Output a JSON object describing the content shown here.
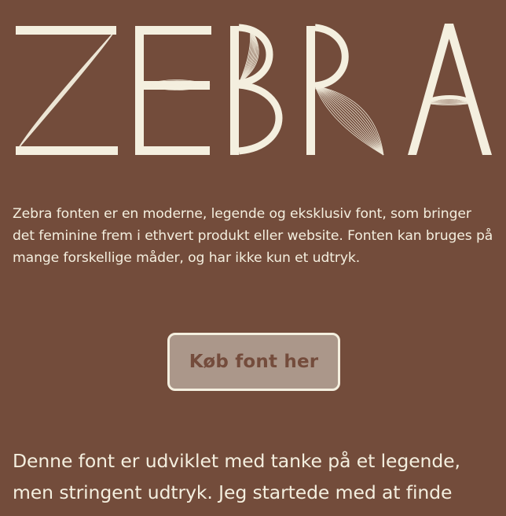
{
  "logo": {
    "text": "ZEBRA",
    "color": "#f4efdf"
  },
  "intro": {
    "text": "Zebra fonten er en moderne, legende og eksklusiv font, som bringer det feminine frem i ethvert produkt eller website. Fonten kan bruges på mange forskellige måder, og har ikke kun et udtryk."
  },
  "cta": {
    "label": "Køb font her"
  },
  "lead": {
    "line1": "Denne font er udviklet med tanke på et legende,",
    "line2": "men stringent udtryk. Jeg startede med at finde"
  },
  "colors": {
    "background": "#734c3b",
    "text": "#f4efdf",
    "button_bg": "#ab978a",
    "button_text": "#744c3c"
  }
}
